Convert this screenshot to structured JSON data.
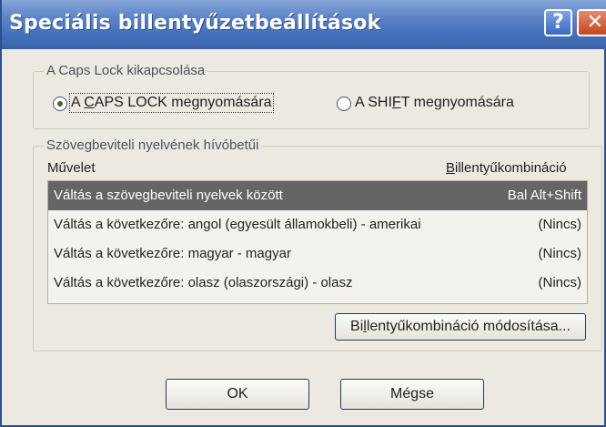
{
  "window": {
    "title": "Speciális billentyűzetbeállítások"
  },
  "titlebar": {
    "help_glyph": "?",
    "close_glyph": "✕"
  },
  "caps_lock": {
    "group_label": "A Caps Lock kikapcsolása",
    "options": [
      {
        "pre": "A ",
        "key": "C",
        "post": "APS LOCK megnyomására",
        "checked": true
      },
      {
        "pre": "A SHI",
        "key": "F",
        "post": "T megnyomására",
        "checked": false
      }
    ]
  },
  "hotkeys": {
    "group_label": "Szövegbeviteli nyelvének hívóbetűi",
    "col_action": "Művelet",
    "col_combo_key": "B",
    "col_combo_rest": "illentyűkombináció",
    "rows": [
      {
        "action": "Váltás a szövegbeviteli nyelvek között",
        "combo": "Bal Alt+Shift",
        "selected": true
      },
      {
        "action": "Váltás a következőre: angol (egyesült államokbeli) - amerikai",
        "combo": "(Nincs)",
        "selected": false
      },
      {
        "action": "Váltás a következőre: magyar - magyar",
        "combo": "(Nincs)",
        "selected": false
      },
      {
        "action": "Váltás a következőre: olasz (olaszországi) - olasz",
        "combo": "(Nincs)",
        "selected": false
      }
    ],
    "change_btn_pre": "Bi",
    "change_btn_key": "l",
    "change_btn_post": "lentyűkombináció módosítása..."
  },
  "footer": {
    "ok": "OK",
    "cancel": "Mégse"
  },
  "colors": {
    "titlebar": "#4471bb",
    "selection": "#656565",
    "dialog_bg": "#ece9e0"
  }
}
